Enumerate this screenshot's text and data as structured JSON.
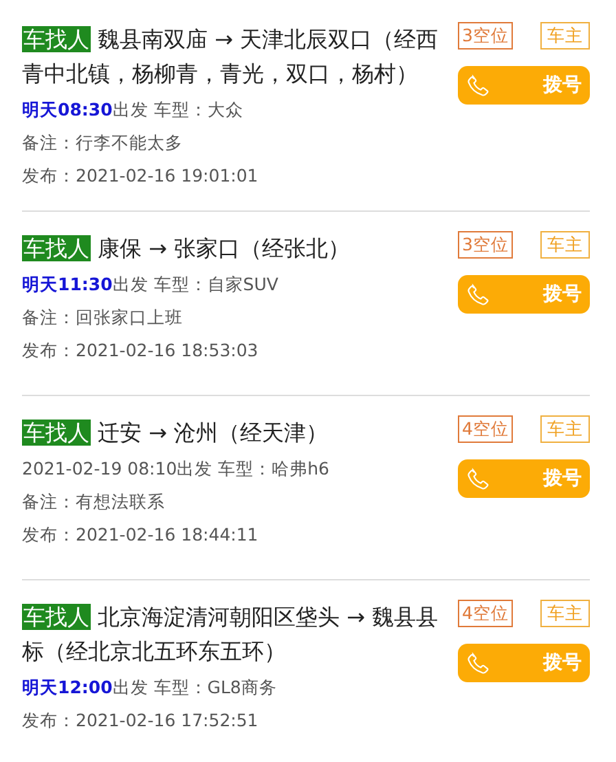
{
  "trips": [
    {
      "tag": "车找人",
      "route": "魏县南双庙 → 天津北辰双口（经西青中北镇，杨柳青，青光，双口，杨村）",
      "seats": "3空位",
      "role": "车主",
      "call": "拨号",
      "time": "明天08:30",
      "time_highlighted": true,
      "details": "出发 车型：大众",
      "note": "备注：行李不能太多",
      "posted": "发布：2021-02-16 19:01:01"
    },
    {
      "tag": "车找人",
      "route": "康保 → 张家口（经张北）",
      "seats": "3空位",
      "role": "车主",
      "call": "拨号",
      "time": "明天11:30",
      "time_highlighted": true,
      "details": "出发 车型：自家SUV",
      "note": "备注：回张家口上班",
      "posted": "发布：2021-02-16 18:53:03"
    },
    {
      "tag": "车找人",
      "route": "迁安 → 沧州（经天津）",
      "seats": "4空位",
      "role": "车主",
      "call": "拨号",
      "time": "2021-02-19 08:10",
      "time_highlighted": false,
      "details": "出发 车型：哈弗h6",
      "note": "备注：有想法联系",
      "posted": "发布：2021-02-16 18:44:11"
    },
    {
      "tag": "车找人",
      "route": "北京海淀清河朝阳区垡头 → 魏县县标（经北京北五环东五环）",
      "seats": "4空位",
      "role": "车主",
      "call": "拨号",
      "time": "明天12:00",
      "time_highlighted": true,
      "details": "出发 车型：GL8商务",
      "posted": "发布：2021-02-16 17:52:51"
    }
  ]
}
